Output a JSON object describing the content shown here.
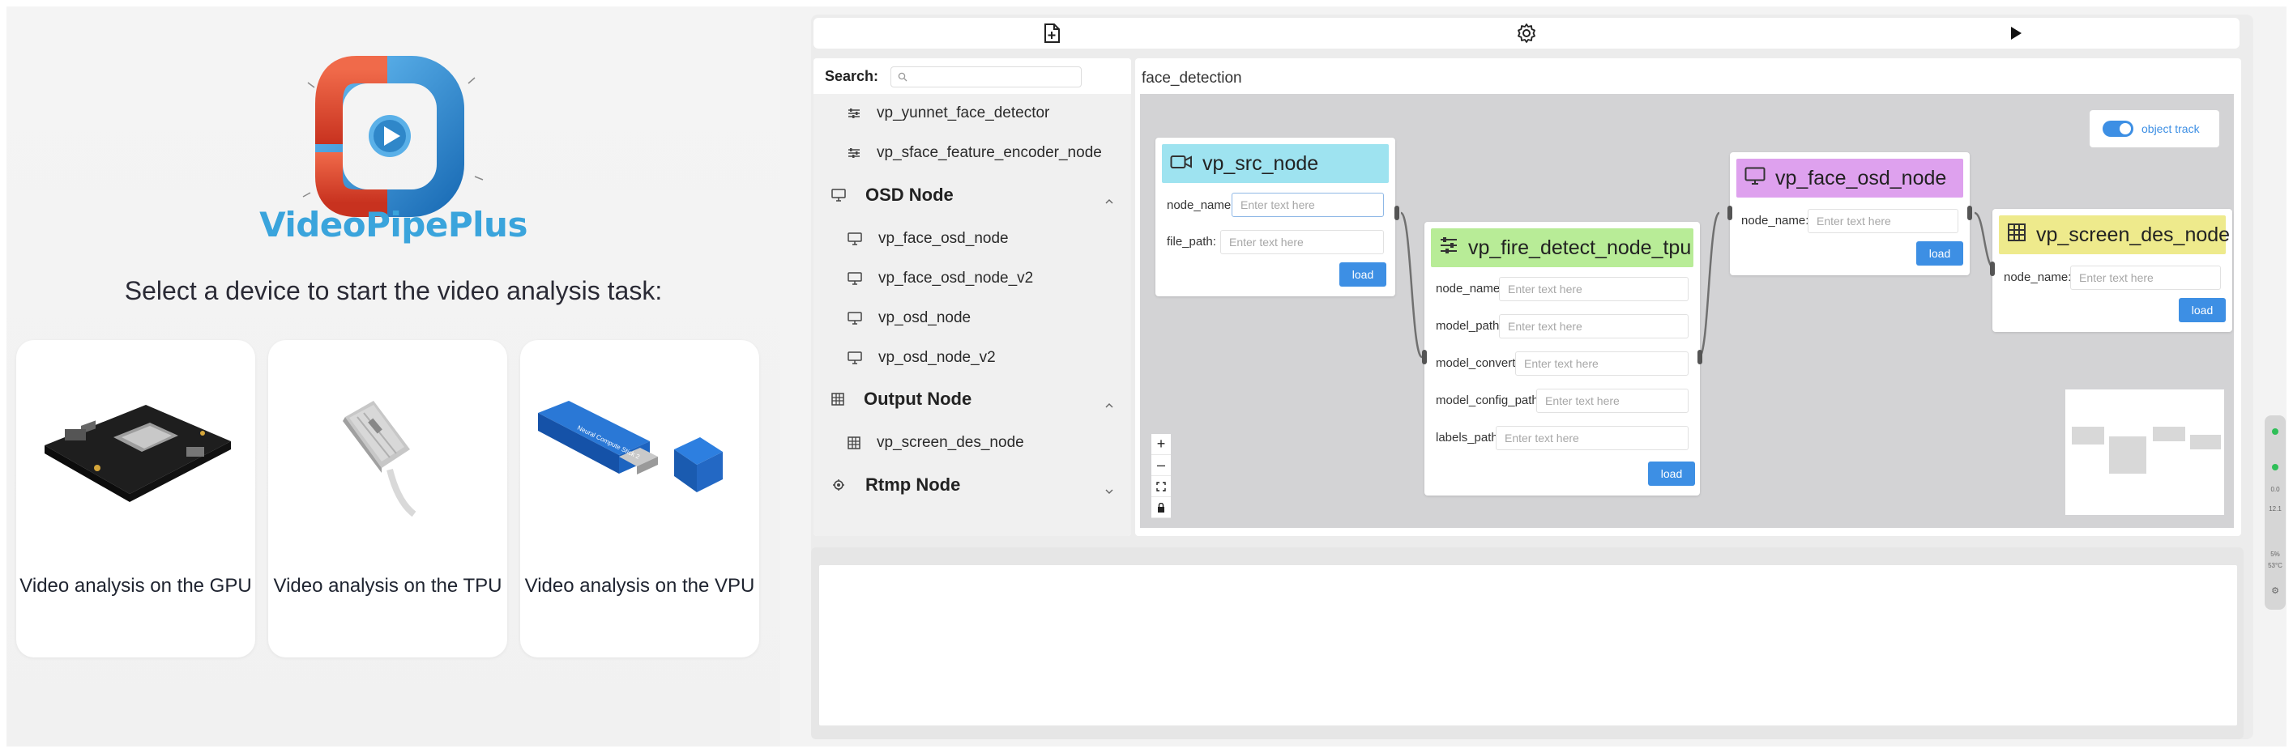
{
  "brand": {
    "name": "VideoPipePlus"
  },
  "landing": {
    "tagline": "Select a device to start the video analysis task:",
    "cards": [
      {
        "label": "Video analysis on the GPU",
        "device_icon": "gpu-board-icon"
      },
      {
        "label": "Video analysis on the TPU",
        "device_icon": "tpu-stick-icon"
      },
      {
        "label": "Video analysis on the VPU",
        "device_icon": "vpu-stick-icon"
      }
    ]
  },
  "toolbar": {
    "icons": [
      "new-file-icon",
      "gear-icon",
      "play-icon"
    ]
  },
  "palette": {
    "search_label": "Search:",
    "search_value": "",
    "items": [
      {
        "type": "item",
        "label": "vp_yunnet_face_detector",
        "icon": "sliders-icon"
      },
      {
        "type": "item",
        "label": "vp_sface_feature_encoder_node",
        "icon": "sliders-icon"
      },
      {
        "type": "group",
        "label": "OSD Node",
        "icon": "monitor-icon",
        "expanded": true
      },
      {
        "type": "item",
        "label": "vp_face_osd_node",
        "icon": "monitor-icon"
      },
      {
        "type": "item",
        "label": "vp_face_osd_node_v2",
        "icon": "monitor-icon"
      },
      {
        "type": "item",
        "label": "vp_osd_node",
        "icon": "monitor-icon"
      },
      {
        "type": "item",
        "label": "vp_osd_node_v2",
        "icon": "monitor-icon"
      },
      {
        "type": "group",
        "label": "Output Node",
        "icon": "grid-icon",
        "expanded": true
      },
      {
        "type": "item",
        "label": "vp_screen_des_node",
        "icon": "grid-icon"
      },
      {
        "type": "group",
        "label": "Rtmp Node",
        "icon": "broadcast-icon",
        "expanded": false
      }
    ]
  },
  "flow": {
    "title": "face_detection",
    "object_track": {
      "label": "object track",
      "enabled": true
    },
    "nodes": [
      {
        "id": "src",
        "title": "vp_src_node",
        "header_color": "#9ee3f0",
        "icon": "video-camera-icon",
        "fields": [
          {
            "label": "node_name:",
            "placeholder": "Enter text here"
          },
          {
            "label": "file_path:",
            "placeholder": "Enter text here"
          }
        ],
        "button": "load"
      },
      {
        "id": "fire",
        "title": "vp_fire_detect_node_tpu",
        "header_color": "#b8ec97",
        "icon": "sliders-icon",
        "fields": [
          {
            "label": "node_name:",
            "placeholder": "Enter text here"
          },
          {
            "label": "model_path:",
            "placeholder": "Enter text here"
          },
          {
            "label": "model_convert:",
            "placeholder": "Enter text here"
          },
          {
            "label": "model_config_path:",
            "placeholder": "Enter text here"
          },
          {
            "label": "labels_path:",
            "placeholder": "Enter text here"
          }
        ],
        "button": "load"
      },
      {
        "id": "osd",
        "title": "vp_face_osd_node",
        "header_color": "#dea1ee",
        "icon": "monitor-icon",
        "fields": [
          {
            "label": "node_name:",
            "placeholder": "Enter text here"
          }
        ],
        "button": "load"
      },
      {
        "id": "des",
        "title": "vp_screen_des_node",
        "header_color": "#eeea8c",
        "icon": "grid-icon",
        "fields": [
          {
            "label": "node_name:",
            "placeholder": "Enter text here"
          }
        ],
        "button": "load"
      }
    ],
    "zoom_controls": [
      "+",
      "–",
      "fit-view-icon",
      "lock-icon"
    ]
  },
  "side_widget": {
    "values": [
      "0.0",
      "12.1",
      "5%",
      "53°C"
    ]
  },
  "colors": {
    "accent": "#3d8fe4",
    "brand": "#3aa4dc",
    "canvas": "#d3d3d5"
  }
}
